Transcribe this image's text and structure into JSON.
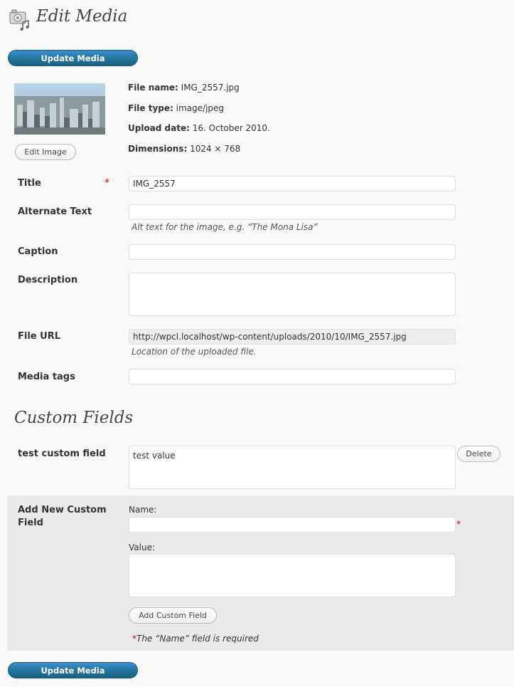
{
  "header": {
    "title": "Edit Media",
    "icon": "media-library-icon"
  },
  "buttons": {
    "update_media_top": "Update Media",
    "update_media_bottom": "Update Media",
    "edit_image": "Edit Image",
    "delete": "Delete",
    "add_custom_field": "Add Custom Field"
  },
  "file_info": {
    "file_name_label": "File name:",
    "file_name": "IMG_2557.jpg",
    "file_type_label": "File type:",
    "file_type": "image/jpeg",
    "upload_date_label": "Upload date:",
    "upload_date": "16. October 2010.",
    "dimensions_label": "Dimensions:",
    "dimensions": "1024 × 768"
  },
  "form": {
    "title_label": "Title",
    "title_value": "IMG_2557",
    "required_mark": "*",
    "alt_label": "Alternate Text",
    "alt_value": "",
    "alt_hint": "Alt text for the image, e.g. “The Mona Lisa”",
    "caption_label": "Caption",
    "caption_value": "",
    "description_label": "Description",
    "description_value": "",
    "file_url_label": "File URL",
    "file_url_value": "http://wpcl.localhost/wp-content/uploads/2010/10/IMG_2557.jpg",
    "file_url_hint": "Location of the uploaded file.",
    "media_tags_label": "Media tags",
    "media_tags_value": ""
  },
  "custom_fields": {
    "section_title": "Custom Fields",
    "items": [
      {
        "name": "test custom field",
        "value": "test value"
      }
    ],
    "add_new": {
      "label": "Add New Custom Field",
      "name_label": "Name:",
      "name_value": "",
      "value_label": "Value:",
      "value_value": "",
      "required_mark": "*",
      "required_note": "The “Name” field is required"
    }
  }
}
